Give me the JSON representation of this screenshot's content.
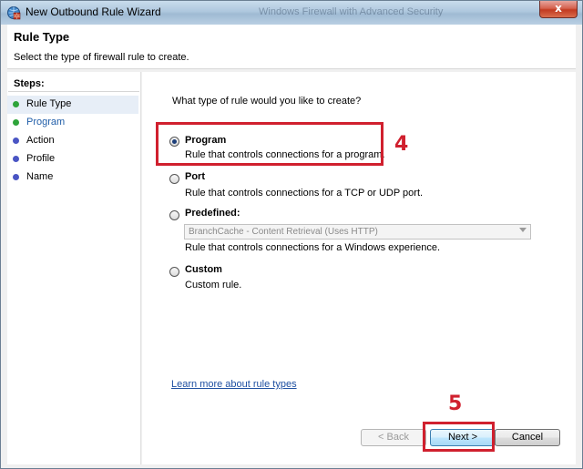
{
  "window": {
    "title": "New Outbound Rule Wizard",
    "background_title": "Windows Firewall with Advanced Security",
    "close_glyph": "x"
  },
  "header": {
    "title": "Rule Type",
    "subtitle": "Select the type of firewall rule to create."
  },
  "steps": {
    "heading": "Steps:",
    "items": [
      {
        "label": "Rule Type",
        "state": "current",
        "dot_color": "#2ea43a"
      },
      {
        "label": "Program",
        "state": "upcoming",
        "dot_color": "#2ea43a"
      },
      {
        "label": "Action",
        "state": "upcoming",
        "dot_color": "#4a55c4"
      },
      {
        "label": "Profile",
        "state": "upcoming",
        "dot_color": "#4a55c4"
      },
      {
        "label": "Name",
        "state": "upcoming",
        "dot_color": "#4a55c4"
      }
    ]
  },
  "main": {
    "question": "What type of rule would you like to create?",
    "options": [
      {
        "label": "Program",
        "description": "Rule that controls connections for a program.",
        "selected": true
      },
      {
        "label": "Port",
        "description": "Rule that controls connections for a TCP or UDP port.",
        "selected": false
      },
      {
        "label": "Predefined:",
        "description": "Rule that controls connections for a Windows experience.",
        "selected": false
      },
      {
        "label": "Custom",
        "description": "Custom rule.",
        "selected": false
      }
    ],
    "predefined_dropdown": {
      "value": "BranchCache - Content Retrieval (Uses HTTP)",
      "enabled": false
    },
    "learn_more_link": "Learn more about rule types"
  },
  "buttons": {
    "back": "< Back",
    "next": "Next >",
    "cancel": "Cancel"
  },
  "annotations": {
    "step4": "4",
    "step5": "5",
    "color": "#d0202e"
  }
}
